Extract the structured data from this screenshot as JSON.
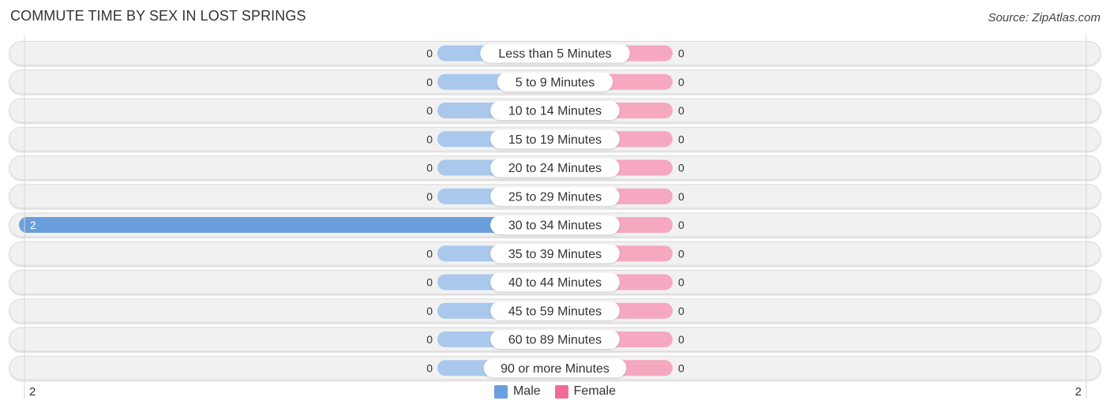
{
  "header": {
    "title": "COMMUTE TIME BY SEX IN LOST SPRINGS",
    "source": "Source: ZipAtlas.com"
  },
  "colors": {
    "male": "#6a9fdc",
    "male_light": "#a9c8ec",
    "female": "#f26b96",
    "female_light": "#f6a8c1",
    "track": "#f1f1f1"
  },
  "chart_data": {
    "type": "bar",
    "orientation": "horizontal-diverging",
    "title": "COMMUTE TIME BY SEX IN LOST SPRINGS",
    "categories": [
      "Less than 5 Minutes",
      "5 to 9 Minutes",
      "10 to 14 Minutes",
      "15 to 19 Minutes",
      "20 to 24 Minutes",
      "25 to 29 Minutes",
      "30 to 34 Minutes",
      "35 to 39 Minutes",
      "40 to 44 Minutes",
      "45 to 59 Minutes",
      "60 to 89 Minutes",
      "90 or more Minutes"
    ],
    "series": [
      {
        "name": "Male",
        "values": [
          0,
          0,
          0,
          0,
          0,
          0,
          2,
          0,
          0,
          0,
          0,
          0
        ]
      },
      {
        "name": "Female",
        "values": [
          0,
          0,
          0,
          0,
          0,
          0,
          0,
          0,
          0,
          0,
          0,
          0
        ]
      }
    ],
    "xlim": [
      -2,
      2
    ],
    "axis_left_label": "2",
    "axis_right_label": "2",
    "legend": [
      "Male",
      "Female"
    ],
    "legend_position": "bottom-center",
    "grid": false
  }
}
